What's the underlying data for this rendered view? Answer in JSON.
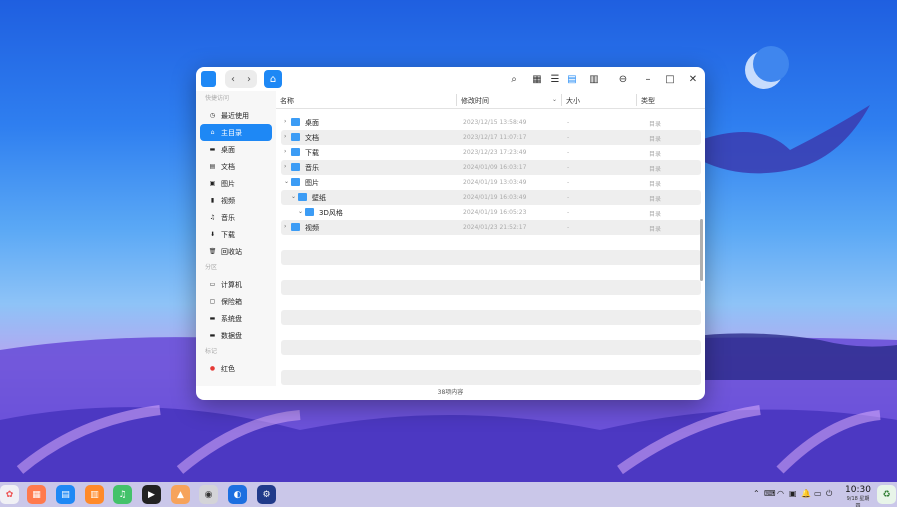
{
  "window": {
    "title_icon": "folder-app-icon",
    "nav_back": "‹",
    "nav_forward": "›",
    "breadcrumb_icon": "home-icon",
    "accent": "#1e88f5"
  },
  "sidebar": {
    "sections": [
      {
        "label": "快捷访问"
      },
      {
        "label": "分区"
      },
      {
        "label": "标记"
      }
    ],
    "quick": [
      {
        "label": "最近使用",
        "icon": "clock-icon",
        "active": false
      },
      {
        "label": "主目录",
        "icon": "home-icon",
        "active": true
      },
      {
        "label": "桌面",
        "icon": "desktop-icon",
        "active": false
      },
      {
        "label": "文档",
        "icon": "document-icon",
        "active": false
      },
      {
        "label": "图片",
        "icon": "picture-icon",
        "active": false
      },
      {
        "label": "视频",
        "icon": "video-icon",
        "active": false
      },
      {
        "label": "音乐",
        "icon": "music-icon",
        "active": false
      },
      {
        "label": "下载",
        "icon": "download-icon",
        "active": false
      },
      {
        "label": "回收站",
        "icon": "trash-icon",
        "active": false
      }
    ],
    "partitions": [
      {
        "label": "计算机",
        "icon": "computer-icon"
      },
      {
        "label": "保险箱",
        "icon": "vault-icon"
      },
      {
        "label": "系统盘",
        "icon": "disk-icon"
      },
      {
        "label": "数据盘",
        "icon": "disk-icon"
      }
    ],
    "tags": [
      {
        "label": "红色",
        "color": "#e53935"
      }
    ]
  },
  "table": {
    "headers": {
      "name": "名称",
      "modified": "修改时间",
      "size": "大小",
      "type": "类型"
    },
    "rows": [
      {
        "name": "桌面",
        "date": "2023/12/15 13:58:49",
        "size": "-",
        "type": "目录",
        "indent": 0,
        "expanded": false
      },
      {
        "name": "文档",
        "date": "2023/12/17 11:07:17",
        "size": "-",
        "type": "目录",
        "indent": 0,
        "expanded": false
      },
      {
        "name": "下载",
        "date": "2023/12/23 17:23:49",
        "size": "-",
        "type": "目录",
        "indent": 0,
        "expanded": false
      },
      {
        "name": "音乐",
        "date": "2024/01/09 16:03:17",
        "size": "-",
        "type": "目录",
        "indent": 0,
        "expanded": false
      },
      {
        "name": "图片",
        "date": "2024/01/19 13:03:49",
        "size": "-",
        "type": "目录",
        "indent": 0,
        "expanded": true
      },
      {
        "name": "壁纸",
        "date": "2024/01/19 16:03:49",
        "size": "-",
        "type": "目录",
        "indent": 1,
        "expanded": true
      },
      {
        "name": "3D风格",
        "date": "2024/01/19 16:05:23",
        "size": "-",
        "type": "目录",
        "indent": 2,
        "expanded": false
      },
      {
        "name": "视频",
        "date": "2024/01/23 21:52:17",
        "size": "-",
        "type": "目录",
        "indent": 0,
        "expanded": false
      }
    ]
  },
  "status": {
    "count": "38项内容"
  },
  "taskbar": {
    "time": "10:30",
    "date": "9/18 星期四"
  }
}
